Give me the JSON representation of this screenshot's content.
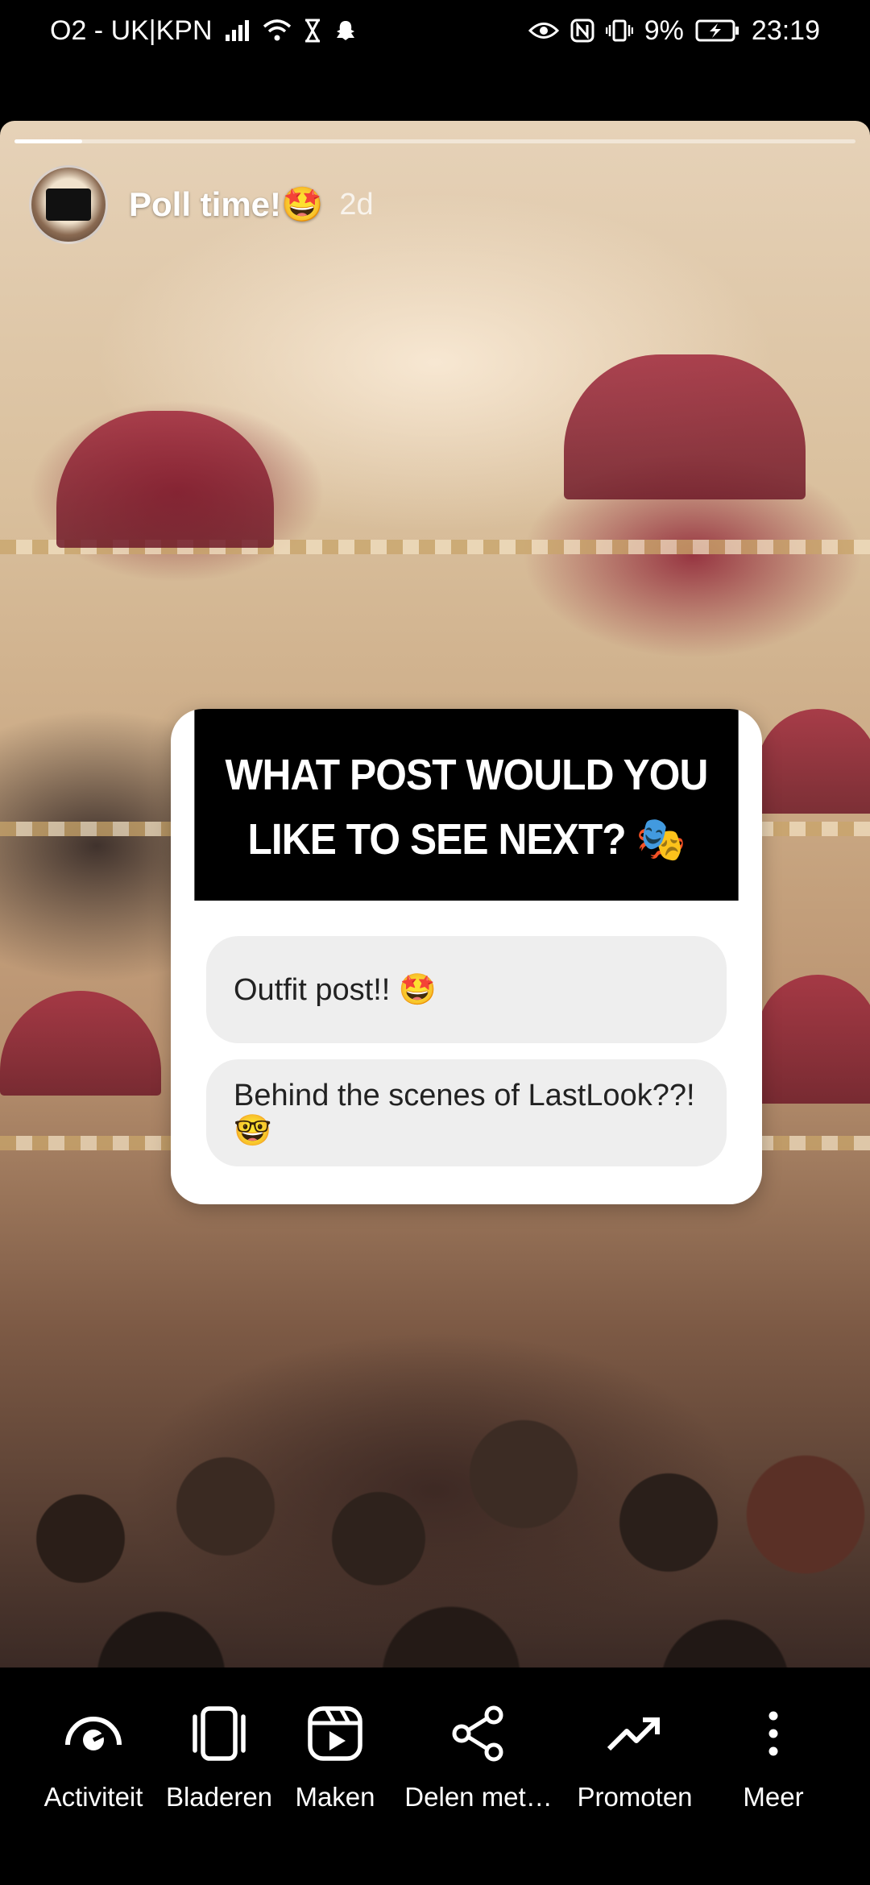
{
  "status_bar": {
    "carrier": "O2 - UK|KPN",
    "battery": "9%",
    "time": "23:19"
  },
  "story": {
    "title": "Poll time!🤩",
    "time_ago": "2d",
    "progress": 0.08,
    "poll": {
      "question": "WHAT POST WOULD YOU LIKE TO SEE NEXT? 🎭",
      "options": [
        {
          "label": "Outfit post!! 🤩"
        },
        {
          "label": "Behind the scenes of LastLook??! 🤓"
        }
      ]
    }
  },
  "toolbar": {
    "items": [
      {
        "label": "Activiteit",
        "icon": "activity-icon"
      },
      {
        "label": "Bladeren",
        "icon": "browse-icon"
      },
      {
        "label": "Maken",
        "icon": "create-reel-icon"
      },
      {
        "label": "Delen met…",
        "icon": "share-icon"
      },
      {
        "label": "Promoten",
        "icon": "trending-icon"
      },
      {
        "label": "Meer",
        "icon": "more-vertical-icon"
      }
    ]
  }
}
